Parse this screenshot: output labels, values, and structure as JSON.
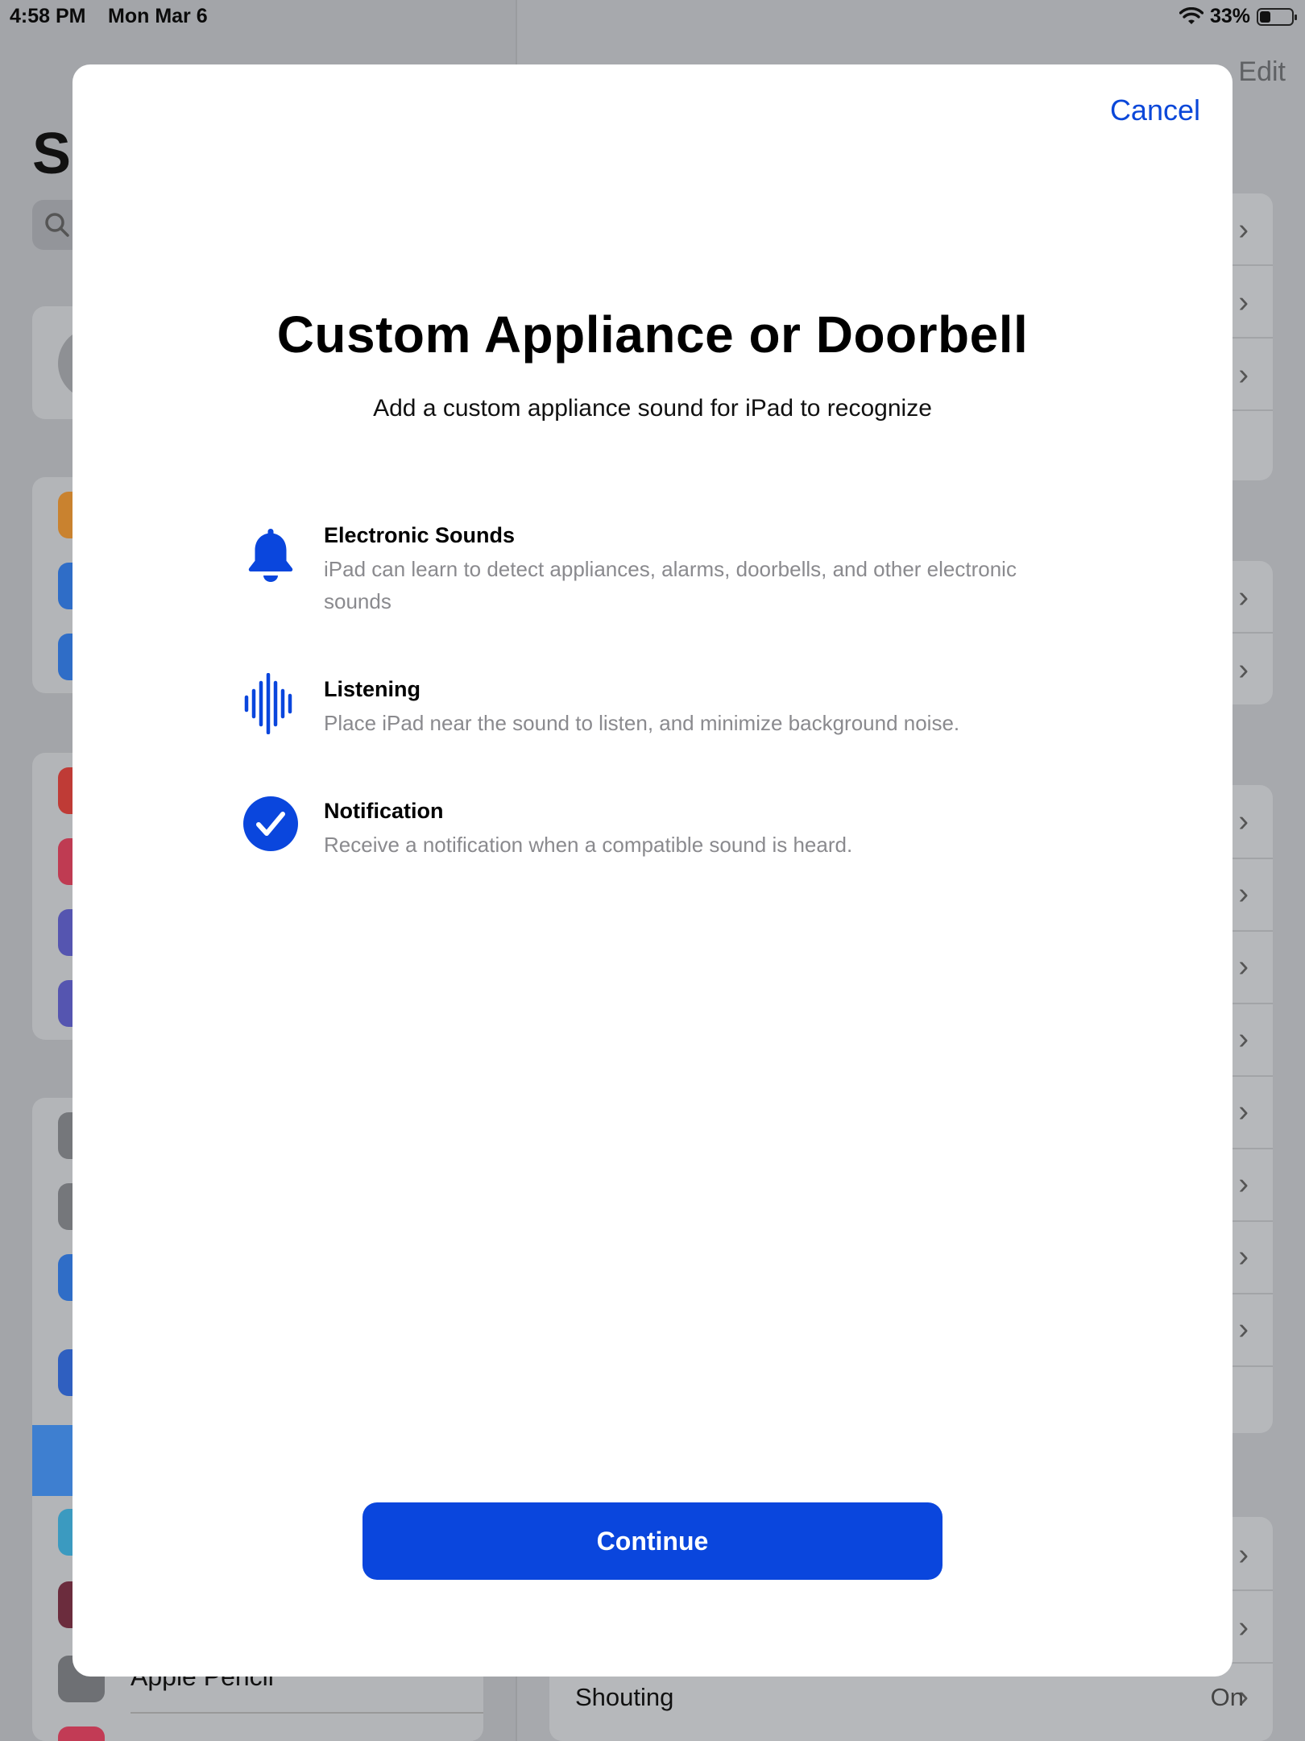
{
  "status_bar": {
    "time": "4:58 PM",
    "date": "Mon Mar 6",
    "battery_percent_label": "33%",
    "battery_level": 0.33
  },
  "background": {
    "sidebar_title_fragment": "Se",
    "sidebar_visible_item": "Apple Pencil",
    "detail_nav_right": "Edit",
    "detail_last_row_label": "Shouting",
    "detail_last_row_value": "On"
  },
  "sheet": {
    "cancel_label": "Cancel",
    "title": "Custom Appliance or Doorbell",
    "subtitle": "Add a custom appliance sound for iPad to recognize",
    "features": [
      {
        "icon": "bell-icon",
        "heading": "Electronic Sounds",
        "description": "iPad can learn to detect appliances, alarms, doorbells, and other electronic sounds"
      },
      {
        "icon": "waveform-icon",
        "heading": "Listening",
        "description": "Place iPad near the sound to listen, and minimize background noise."
      },
      {
        "icon": "checkmark-circle-icon",
        "heading": "Notification",
        "description": "Receive a notification when a compatible sound is heard."
      }
    ],
    "continue_label": "Continue"
  },
  "colors": {
    "accent": "#0a46dd",
    "secondary_text": "#8a8a8e",
    "dimmed_background": "#a7a9ad"
  }
}
